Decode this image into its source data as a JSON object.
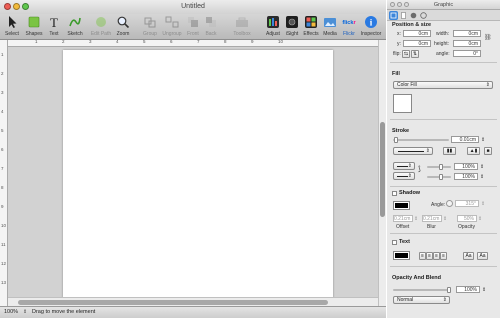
{
  "window": {
    "title": "Untitled"
  },
  "toolbar": [
    {
      "id": "select",
      "label": "Select",
      "icon": "pointer-icon",
      "enabled": true
    },
    {
      "id": "shapes",
      "label": "Shapes",
      "icon": "shapes-icon",
      "enabled": true
    },
    {
      "id": "text",
      "label": "Text",
      "icon": "text-icon",
      "enabled": true
    },
    {
      "id": "sketch",
      "label": "Sketch",
      "icon": "sketch-icon",
      "enabled": true
    },
    {
      "id": "edit-path",
      "label": "Edit Path",
      "icon": "edit-path-icon",
      "enabled": false
    },
    {
      "id": "zoom",
      "label": "Zoom",
      "icon": "zoom-icon",
      "enabled": true
    },
    {
      "id": "group",
      "label": "Group",
      "icon": "group-icon",
      "enabled": false
    },
    {
      "id": "ungroup",
      "label": "Ungroup",
      "icon": "ungroup-icon",
      "enabled": false
    },
    {
      "id": "front",
      "label": "Front",
      "icon": "front-icon",
      "enabled": false
    },
    {
      "id": "back",
      "label": "Back",
      "icon": "back-icon",
      "enabled": false
    },
    {
      "id": "toolbox",
      "label": "Toolbox",
      "icon": "toolbox-icon",
      "enabled": false
    },
    {
      "id": "adjust",
      "label": "Adjust",
      "icon": "adjust-icon",
      "enabled": true
    },
    {
      "id": "isight",
      "label": "iSight",
      "icon": "camera-icon",
      "enabled": true
    },
    {
      "id": "effects",
      "label": "Effects",
      "icon": "effects-icon",
      "enabled": true
    },
    {
      "id": "media",
      "label": "Media",
      "icon": "media-icon",
      "enabled": true
    },
    {
      "id": "flickr",
      "label": "Flickr",
      "icon": "flickr-icon",
      "enabled": true
    },
    {
      "id": "inspector",
      "label": "Inspector",
      "icon": "info-icon",
      "enabled": true
    }
  ],
  "flickr_logo": "flickr",
  "ruler": {
    "h": [
      "1",
      "2",
      "3",
      "4",
      "5",
      "6",
      "7",
      "8",
      "9",
      "10"
    ],
    "v": [
      "1",
      "2",
      "3",
      "4",
      "5",
      "6",
      "7",
      "8",
      "9",
      "10",
      "11",
      "12",
      "13"
    ]
  },
  "status": {
    "zoom": "100%",
    "message": "Drag to move the element"
  },
  "inspector": {
    "title": "Graphic",
    "position_size": {
      "heading": "Position & size",
      "x_label": "x:",
      "x": "0cm",
      "width_label": "width:",
      "width": "0cm",
      "y_label": "y:",
      "y": "0cm",
      "height_label": "height:",
      "height": "0cm",
      "flip_label": "flip:",
      "angle_label": "angle:",
      "angle": "0°"
    },
    "fill": {
      "heading": "Fill",
      "mode": "Color Fill",
      "color": "#ffffff"
    },
    "stroke": {
      "heading": "Stroke",
      "width": "0.01cm",
      "width_fraction": 0.02,
      "opacity1": "100%",
      "opacity2": "100%"
    },
    "shadow": {
      "heading": "Shadow",
      "checked": false,
      "color": "#000000",
      "angle_label": "Angle:",
      "angle": "315°",
      "offset": "0.21cm",
      "blur": "0.21cm",
      "opacity": "50%",
      "offset_label": "Offset",
      "blur_label": "Blur",
      "opacity_label": "Opacity"
    },
    "text": {
      "heading": "Text",
      "checked": false,
      "color": "#000000"
    },
    "opacity_blend": {
      "heading": "Opacity And Blend",
      "opacity": "100%",
      "opacity_fraction": 1.0,
      "blend_mode": "Normal"
    }
  },
  "colors": {
    "selected_tab": "#3d86da",
    "flickr_blue": "#0063dc",
    "flickr_pink": "#ff0084"
  }
}
